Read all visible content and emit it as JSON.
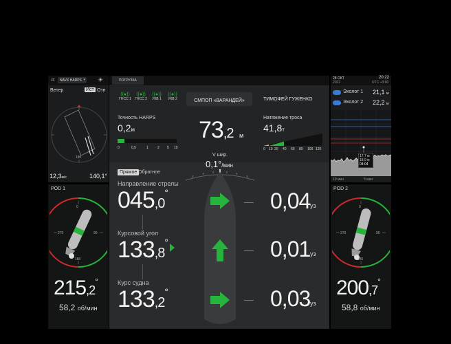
{
  "left_top": {
    "logo": "//F",
    "dropdown": "NAVX HARPS",
    "wind_label": "Ветер",
    "toggle_true": "Ист",
    "toggle_rel": "Отн",
    "wind_speed_int": "12,3",
    "wind_speed_unit": "м/с",
    "wind_dir": "140,1°",
    "compass_labels": [
      "0",
      "90",
      "180",
      "270"
    ]
  },
  "pod1": {
    "label": "POD 1",
    "angle_int": "215",
    "angle_dec": ",2",
    "angle_deg": "°",
    "rpm_val": "58,2",
    "rpm_unit": "об/мин",
    "dial_labels": [
      "0",
      "90",
      "180",
      "270"
    ]
  },
  "pod2": {
    "label": "POD 2",
    "angle_int": "200",
    "angle_dec": ",7",
    "angle_deg": "°",
    "rpm_val": "58,8",
    "rpm_unit": "об/мин",
    "dial_labels": [
      "0",
      "90",
      "180",
      "270"
    ]
  },
  "center": {
    "tab": "ПОГРУЗКА",
    "signals": [
      "ГНСС 1",
      "ГНСС 2",
      "УКВ 1",
      "УКВ 2"
    ],
    "vessel_name": "СМПОП «ВАРАНДЕЙ»",
    "person_name": "ТИМОФЕЙ ГУЖЕНКО",
    "harps_label": "Точность HARPS",
    "harps_val": "0,2",
    "harps_unit": "м",
    "harps_scale": [
      "0",
      "0,5",
      "1",
      "2",
      "5",
      "10"
    ],
    "harps_level": 0.12,
    "distance_val": "73",
    "distance_dec": ",2",
    "distance_unit": "м",
    "tension_label": "Натяжение троса",
    "tension_val": "41,8",
    "tension_unit": "т",
    "tension_scale": [
      "0",
      "10",
      "20",
      "40",
      "60",
      "80",
      "100",
      "120"
    ],
    "tension_level": 0.35,
    "v_label": "V шир.",
    "v_val": "0,1°",
    "v_unit": "/мин",
    "mode_direct": "Прямое",
    "mode_reverse": "Обратное",
    "boom_label": "Направление стрелы",
    "boom_int": "045",
    "boom_dec": ",0",
    "boom_deg": "°",
    "heading_label": "Курсовой угол",
    "heading_int": "133",
    "heading_dec": ",8",
    "heading_deg": "°",
    "course_label": "Курс судна",
    "course_int": "133",
    "course_dec": ",2",
    "course_deg": "°",
    "speeds": [
      {
        "val": "0,04",
        "unit": "уз"
      },
      {
        "val": "0,01",
        "unit": "уз"
      },
      {
        "val": "0,03",
        "unit": "уз"
      }
    ]
  },
  "right_top": {
    "date": "28 ОКТ",
    "year": "2022",
    "time": "20:22",
    "tz": "UTC +3:00",
    "sounder1_label": "Эхолот 1",
    "sounder1_val": "21,1",
    "sounder1_unit": "м",
    "sounder2_label": "Эхолот 2",
    "sounder2_val": "22,2",
    "sounder2_unit": "м",
    "tooltip_line1": "17,7 м",
    "tooltip_line2": "18,9 м",
    "tooltip_time": "04:04",
    "chart_xlabel_left": "10 мин",
    "chart_xlabel_right": "5 мин",
    "chart_ylabels": [
      "15",
      "20",
      "25"
    ]
  },
  "colors": {
    "green": "#26b43c",
    "yellow": "#e8b81c",
    "red": "#cc2a2a",
    "blue": "#3a7bd5",
    "panel": "#1b1c1d"
  },
  "chart_data": {
    "type": "area",
    "title": "",
    "series": [
      {
        "name": "Эхолот",
        "values": [
          19.3,
          18.8,
          19.5,
          18.6,
          19.2,
          18.9,
          19.8,
          18.4,
          19.1,
          20.3,
          19.0,
          19.6,
          18.7,
          19.4,
          20.1,
          19.2,
          20.6,
          19.5,
          21.4,
          19.8,
          22.0,
          20.4,
          21.0,
          20.6,
          21.4,
          20.8,
          21.2,
          20.9,
          21.5,
          21.1,
          21.6,
          21.0,
          21.3,
          21.5
        ]
      }
    ]
  }
}
